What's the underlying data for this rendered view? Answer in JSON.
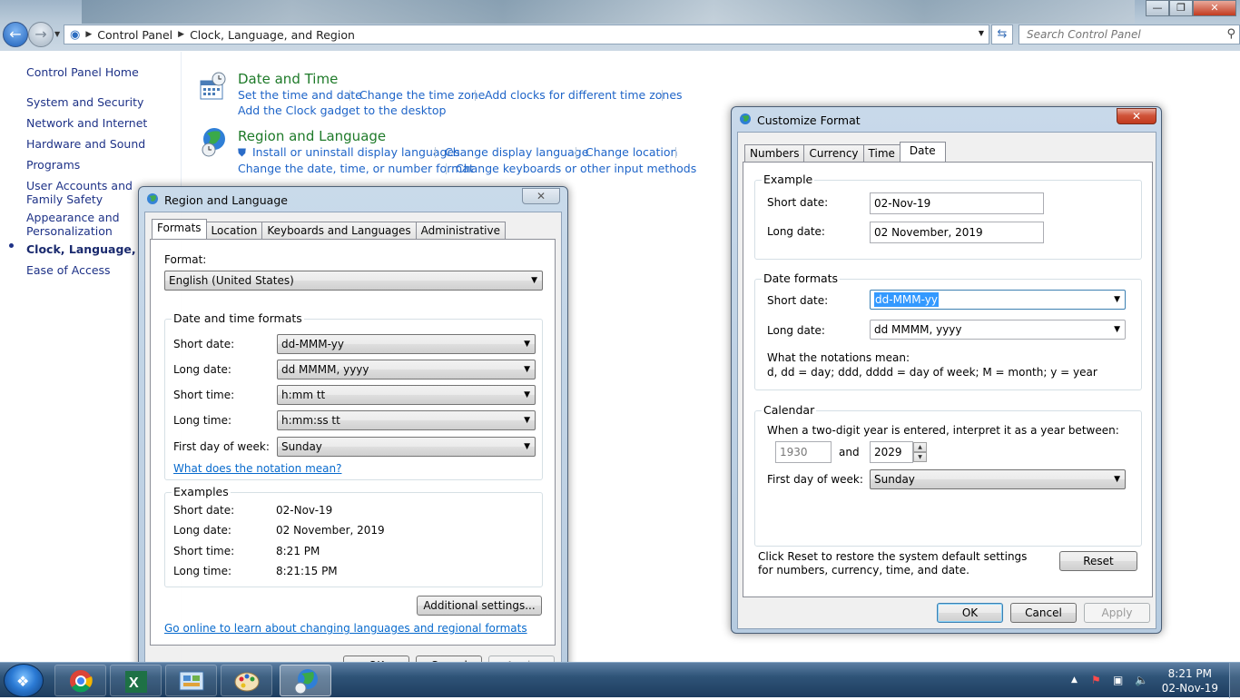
{
  "explorer": {
    "breadcrumb": [
      "Control Panel",
      "Clock, Language, and Region"
    ],
    "search_placeholder": "Search Control Panel"
  },
  "leftnav": {
    "items": [
      {
        "label": "Control Panel Home"
      },
      {
        "label": "System and Security"
      },
      {
        "label": "Network and Internet"
      },
      {
        "label": "Hardware and Sound"
      },
      {
        "label": "Programs"
      },
      {
        "label": "User Accounts and Family Safety"
      },
      {
        "label": "Appearance and Personalization"
      },
      {
        "label": "Clock, Language, and Region"
      },
      {
        "label": "Ease of Access"
      }
    ]
  },
  "main": {
    "date_time": {
      "title": "Date and Time",
      "links": [
        "Set the time and date",
        "Change the time zone",
        "Add clocks for different time zones",
        "Add the Clock gadget to the desktop"
      ]
    },
    "region_language": {
      "title": "Region and Language",
      "links": [
        "Install or uninstall display languages",
        "Change display language",
        "Change location",
        "Change the date, time, or number format",
        "Change keyboards or other input methods"
      ]
    }
  },
  "region_dialog": {
    "title": "Region and Language",
    "tabs": [
      "Formats",
      "Location",
      "Keyboards and Languages",
      "Administrative"
    ],
    "format_label": "Format:",
    "format_value": "English (United States)",
    "dt_group_title": "Date and time formats",
    "rows": [
      {
        "label": "Short date:",
        "value": "dd-MMM-yy"
      },
      {
        "label": "Long date:",
        "value": "dd MMMM, yyyy"
      },
      {
        "label": "Short time:",
        "value": "h:mm tt"
      },
      {
        "label": "Long time:",
        "value": "h:mm:ss tt"
      },
      {
        "label": "First day of week:",
        "value": "Sunday"
      }
    ],
    "notation_link": "What does the notation mean?",
    "examples_title": "Examples",
    "examples": [
      {
        "label": "Short date:",
        "value": "02-Nov-19"
      },
      {
        "label": "Long date:",
        "value": "02 November, 2019"
      },
      {
        "label": "Short time:",
        "value": "8:21 PM"
      },
      {
        "label": "Long time:",
        "value": "8:21:15 PM"
      }
    ],
    "additional_button": "Additional settings...",
    "online_link": "Go online to learn about changing languages and regional formats",
    "ok": "OK",
    "cancel": "Cancel",
    "apply": "Apply"
  },
  "customize_dialog": {
    "title": "Customize Format",
    "tabs": [
      "Numbers",
      "Currency",
      "Time",
      "Date"
    ],
    "example_title": "Example",
    "short_date_label": "Short date:",
    "short_date_example": "02-Nov-19",
    "long_date_label": "Long date:",
    "long_date_example": "02 November, 2019",
    "formats_title": "Date formats",
    "short_date_format": "dd-MMM-yy",
    "long_date_format": "dd MMMM, yyyy",
    "notations_heading": "What the notations mean:",
    "notations_text": "d, dd = day;  ddd, dddd = day of week;  M = month;  y = year",
    "calendar_title": "Calendar",
    "two_digit_text": "When a two-digit year is entered, interpret it as a year between:",
    "year_from": "1930",
    "and_label": "and",
    "year_to": "2029",
    "first_day_label": "First day of week:",
    "first_day_value": "Sunday",
    "reset_text": "Click Reset to restore the system default settings for numbers, currency, time, and date.",
    "reset_button": "Reset",
    "ok": "OK",
    "cancel": "Cancel",
    "apply": "Apply"
  },
  "taskbar": {
    "time": "8:21 PM",
    "date": "02-Nov-19"
  }
}
